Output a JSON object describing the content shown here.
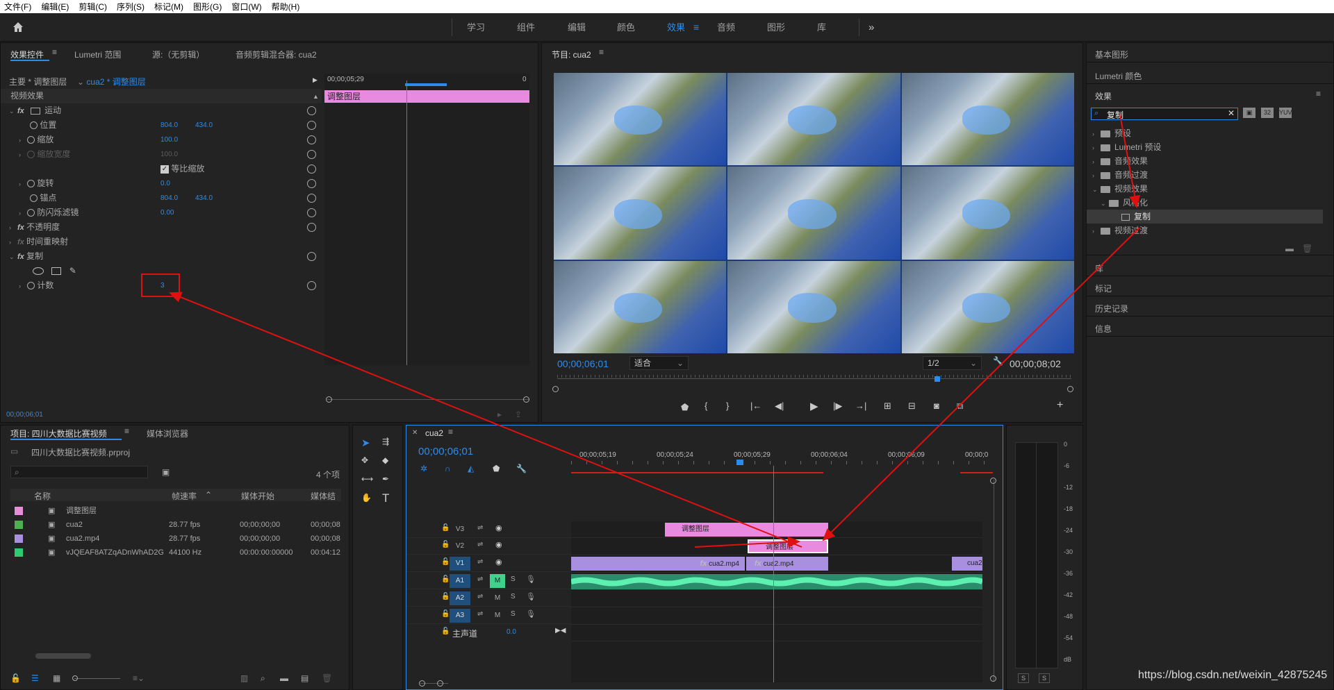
{
  "menu": [
    "文件(F)",
    "编辑(E)",
    "剪辑(C)",
    "序列(S)",
    "标记(M)",
    "图形(G)",
    "窗口(W)",
    "帮助(H)"
  ],
  "workspaces": [
    "学习",
    "组件",
    "编辑",
    "颜色",
    "效果",
    "音频",
    "图形",
    "库"
  ],
  "effect_controls": {
    "tabs": [
      "效果控件",
      "Lumetri 范围",
      "源:（无剪辑）",
      "音频剪辑混合器: cua2"
    ],
    "master": "主要 * 调整图层",
    "clip": "cua2 * 调整图层",
    "timecode_top": "00;00;05;29",
    "timecode_top_right": "0",
    "clip_bar": "调整图层",
    "section": "视频效果",
    "motion": "运动",
    "position": "位置",
    "position_x": "804.0",
    "position_y": "434.0",
    "scale": "缩放",
    "scale_val": "100.0",
    "scale_width": "缩放宽度",
    "scale_width_val": "100.0",
    "uniform": "等比缩放",
    "rotation": "旋转",
    "rotation_val": "0.0",
    "anchor": "锚点",
    "anchor_x": "804.0",
    "anchor_y": "434.0",
    "flicker": "防闪烁滤镜",
    "flicker_val": "0.00",
    "opacity": "不透明度",
    "time_remap": "时间重映射",
    "replicate": "复制",
    "count": "计数",
    "count_val": "3",
    "timecode_bottom": "00;00;06;01"
  },
  "program": {
    "title": "节目: cua2",
    "timecode": "00;00;06;01",
    "fit": "适合",
    "quality": "1/2",
    "duration": "00;00;08;02"
  },
  "right_panel": {
    "basic_graphics": "基本图形",
    "lumetri_color": "Lumetri 颜色",
    "effects": "效果",
    "search_value": "复制",
    "tree": [
      "预设",
      "Lumetri 预设",
      "音频效果",
      "音频过渡",
      "视频效果",
      "风格化",
      "复制",
      "视频过渡"
    ],
    "library": "库",
    "markers": "标记",
    "history": "历史记录",
    "info": "信息"
  },
  "project": {
    "tabs": [
      "项目: 四川大数据比赛视频",
      "媒体浏览器"
    ],
    "file": "四川大数据比赛视频.prproj",
    "count": "4 个项",
    "columns": [
      "名称",
      "帧速率",
      "媒体开始",
      "媒体结"
    ],
    "rows": [
      {
        "name": "调整图层",
        "fps": "",
        "start": "",
        "end": "",
        "color": "#e58fd9"
      },
      {
        "name": "cua2",
        "fps": "28.77 fps",
        "start": "00;00;00;00",
        "end": "00;00;08",
        "color": "#4caf50"
      },
      {
        "name": "cua2.mp4",
        "fps": "28.77 fps",
        "start": "00;00;00;00",
        "end": "00;00;08",
        "color": "#a98fe0"
      },
      {
        "name": "vJQEAF8ATZqADnWhAD2G",
        "fps": "44100 Hz",
        "start": "00:00:00:00000",
        "end": "00:04:12",
        "color": "#2ecc71"
      }
    ]
  },
  "timeline": {
    "title": "cua2",
    "timecode": "00;00;06;01",
    "ruler": [
      "00;00;05;19",
      "00;00;05;24",
      "00;00;05;29",
      "00;00;06;04",
      "00;00;06;09",
      "00;00;0"
    ],
    "tracks": [
      "V3",
      "V2",
      "V1",
      "A1",
      "A2",
      "A3"
    ],
    "master": "主声道",
    "master_val": "0.0",
    "clip_adjust1": "调整图层",
    "clip_adjust2": "调整图层",
    "clip_v1a": "cua2.mp4",
    "clip_v1b": "cua2.mp4",
    "clip_v1c": "cua2"
  },
  "meter_scale": [
    "0",
    "-6",
    "-12",
    "-18",
    "-24",
    "-30",
    "-36",
    "-42",
    "-48",
    "-54",
    "dB"
  ],
  "watermark": "https://blog.csdn.net/weixin_42875245"
}
